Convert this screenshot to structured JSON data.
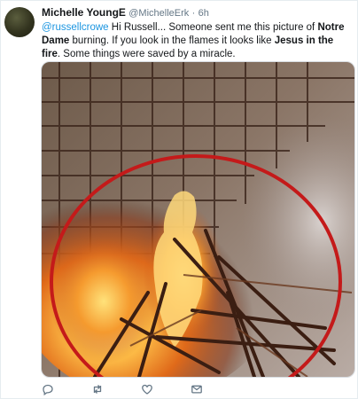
{
  "tweet": {
    "author_name": "Michelle YoungE",
    "handle": "@MichelleErk",
    "separator": "·",
    "time": "6h",
    "text": {
      "mention": "@russellcrowe",
      "part1": " Hi Russell... Someone sent me this picture of ",
      "bold1": "Notre Dame",
      "part2": " burning. If you look in the flames it looks like ",
      "bold2": "Jesus in the fire",
      "part3": ". Some things were saved by a miracle."
    },
    "actions": {
      "reply_icon": "reply-icon",
      "retweet_icon": "retweet-icon",
      "like_icon": "heart-icon",
      "message_icon": "envelope-icon"
    }
  },
  "colors": {
    "link": "#1b95e0",
    "muted": "#657786",
    "circle": "#c41a1a"
  }
}
